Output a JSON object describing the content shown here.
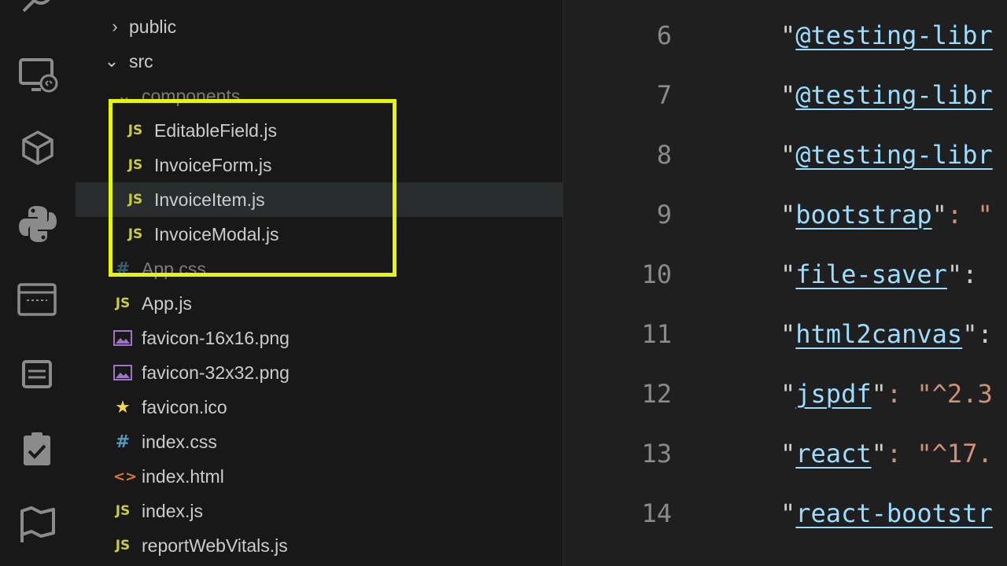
{
  "explorer": {
    "items": [
      {
        "label": "public",
        "type": "folder",
        "expanded": false
      },
      {
        "label": "src",
        "type": "folder",
        "expanded": true
      },
      {
        "label": "components",
        "type": "folder",
        "expanded": true
      },
      {
        "label": "EditableField.js",
        "type": "js"
      },
      {
        "label": "InvoiceForm.js",
        "type": "js"
      },
      {
        "label": "InvoiceItem.js",
        "type": "js"
      },
      {
        "label": "InvoiceModal.js",
        "type": "js"
      },
      {
        "label": "App.css",
        "type": "css"
      },
      {
        "label": "App.js",
        "type": "js"
      },
      {
        "label": "favicon-16x16.png",
        "type": "image"
      },
      {
        "label": "favicon-32x32.png",
        "type": "image"
      },
      {
        "label": "favicon.ico",
        "type": "favicon"
      },
      {
        "label": "index.css",
        "type": "css"
      },
      {
        "label": "index.html",
        "type": "html"
      },
      {
        "label": "index.js",
        "type": "js"
      },
      {
        "label": "reportWebVitals.js",
        "type": "js"
      }
    ],
    "icon_glyphs": {
      "js": "JS",
      "css": "#",
      "html": "<>",
      "favicon": "★"
    }
  },
  "activity_bar": {
    "icons": [
      "search-icon",
      "remote-explorer-icon",
      "extensions-icon",
      "python-icon",
      "remote-window-icon",
      "panel-icon",
      "testing-icon",
      "flag-icon"
    ]
  },
  "editor": {
    "lines": [
      {
        "number": "6",
        "key": "@testing-libr",
        "rest": ""
      },
      {
        "number": "7",
        "key": "@testing-libr",
        "rest": ""
      },
      {
        "number": "8",
        "key": "@testing-libr",
        "rest": ""
      },
      {
        "number": "9",
        "key": "bootstrap",
        "rest": ": \""
      },
      {
        "number": "10",
        "key": "file-saver",
        "rest": ":"
      },
      {
        "number": "11",
        "key": "html2canvas",
        "rest": ":"
      },
      {
        "number": "12",
        "key": "jspdf",
        "rest": ": \"^2.3"
      },
      {
        "number": "13",
        "key": "react",
        "rest": ": \"^17."
      },
      {
        "number": "14",
        "key": "react-bootstr",
        "rest": ""
      }
    ]
  },
  "colors": {
    "highlight": "#e6f50f",
    "background": "#1f1f1f",
    "sidebar": "#181818",
    "js_icon": "#cbcb41",
    "string": "#ce9178"
  }
}
